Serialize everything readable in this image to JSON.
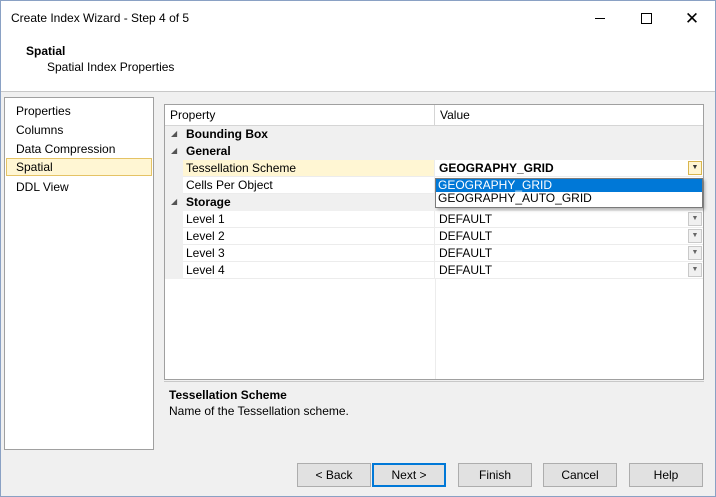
{
  "window": {
    "title": "Create Index Wizard - Step 4 of 5",
    "controls": {
      "minimize": "minimize-icon",
      "maximize": "maximize-icon",
      "close": "✕"
    }
  },
  "banner": {
    "title": "Spatial",
    "subtitle": "Spatial Index Properties"
  },
  "nav": {
    "items": [
      {
        "label": "Properties",
        "selected": false
      },
      {
        "label": "Columns",
        "selected": false
      },
      {
        "label": "Data Compression",
        "selected": false
      },
      {
        "label": "Spatial",
        "selected": true
      },
      {
        "label": "DDL View",
        "selected": false
      }
    ]
  },
  "grid": {
    "columns": {
      "property": "Property",
      "value": "Value"
    },
    "categories": {
      "bounding_box": "Bounding Box",
      "general": "General",
      "storage": "Storage"
    },
    "general_rows": [
      {
        "property": "Tessellation Scheme",
        "value": "GEOGRAPHY_GRID"
      },
      {
        "property": "Cells Per Object",
        "value": ""
      }
    ],
    "storage_rows": [
      {
        "property": "Level 1",
        "value": "DEFAULT"
      },
      {
        "property": "Level 2",
        "value": "DEFAULT"
      },
      {
        "property": "Level 3",
        "value": "DEFAULT"
      },
      {
        "property": "Level 4",
        "value": "DEFAULT"
      }
    ],
    "dropdown_options": [
      "GEOGRAPHY_GRID",
      "GEOGRAPHY_AUTO_GRID"
    ],
    "dropdown_highlighted": "GEOGRAPHY_GRID"
  },
  "description": {
    "title": "Tessellation Scheme",
    "text": "Name of the Tessellation scheme."
  },
  "buttons": {
    "back": "< Back",
    "next": "Next >",
    "finish": "Finish",
    "cancel": "Cancel",
    "help": "Help"
  },
  "colors": {
    "selection": "#fff6d3",
    "highlight": "#0078d7"
  }
}
